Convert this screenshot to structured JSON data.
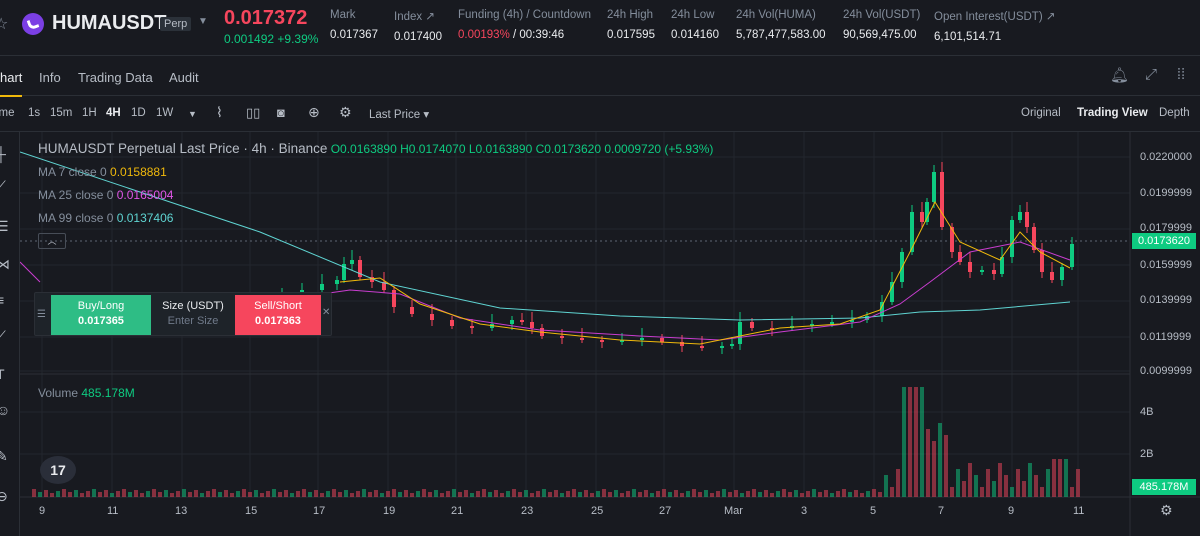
{
  "header": {
    "symbol": "HUMAUSDT",
    "badge": "Perp",
    "price": "0.017372",
    "change": "0.001492 +9.39%",
    "stats": [
      {
        "label": "Mark",
        "value": "0.017367"
      },
      {
        "label": "Index ↗",
        "value": "0.017400"
      },
      {
        "label": "Funding (4h) / Countdown",
        "value_neg": "0.00193%",
        "value": " / 00:39:46"
      },
      {
        "label": "24h High",
        "value": "0.017595"
      },
      {
        "label": "24h Low",
        "value": "0.014160"
      },
      {
        "label": "24h Vol(HUMA)",
        "value": "5,787,477,583.00"
      },
      {
        "label": "24h Vol(USDT)",
        "value": "90,569,475.00"
      },
      {
        "label": "Open Interest(USDT) ↗",
        "value": "6,101,514.71"
      }
    ]
  },
  "tabs": [
    "hart",
    "Info",
    "Trading Data",
    "Audit"
  ],
  "toolbar": {
    "time_label": "ime",
    "intervals": [
      "1s",
      "15m",
      "1H",
      "4H",
      "1D",
      "1W"
    ],
    "price_type": "Last Price ▾",
    "views": [
      "Original",
      "Trading View",
      "Depth"
    ]
  },
  "chart": {
    "title": "HUMAUSDT Perpetual Last Price · 4h · Binance",
    "ohlc": {
      "o": "O0.0163890",
      "h": "H0.0174070",
      "l": "L0.0163890",
      "c": "C0.0173620",
      "chg": "0.0009720 (+5.93%)"
    },
    "ma": [
      {
        "label": "MA 7 close 0",
        "value": "0.0158881",
        "color": "#f0b90b"
      },
      {
        "label": "MA 25 close 0",
        "value": "0.0165004",
        "color": "#c93dcf"
      },
      {
        "label": "MA 99 close 0",
        "value": "0.0137406",
        "color": "#5fd4d2"
      }
    ],
    "volume_label": "Volume",
    "volume_value": "485.178M",
    "price_tag": "0.0173620",
    "volume_tag": "485.178M",
    "y_ticks": [
      "0.0220000",
      "0.0199999",
      "0.0179999",
      "0.0159999",
      "0.0139999",
      "0.0119999",
      "0.0099999"
    ],
    "vol_ticks": [
      "4B",
      "2B"
    ],
    "x_ticks": [
      "9",
      "11",
      "13",
      "15",
      "17",
      "19",
      "21",
      "23",
      "25",
      "27",
      "Mar",
      "3",
      "5",
      "7",
      "9",
      "11"
    ]
  },
  "trade_panel": {
    "buy_label": "Buy/Long",
    "buy_price": "0.017365",
    "size_label": "Size (USDT)",
    "size_placeholder": "Enter Size",
    "sell_label": "Sell/Short",
    "sell_price": "0.017363"
  },
  "colors": {
    "up": "#0ecb81",
    "down": "#f6465d",
    "accent": "#f0b90b"
  }
}
